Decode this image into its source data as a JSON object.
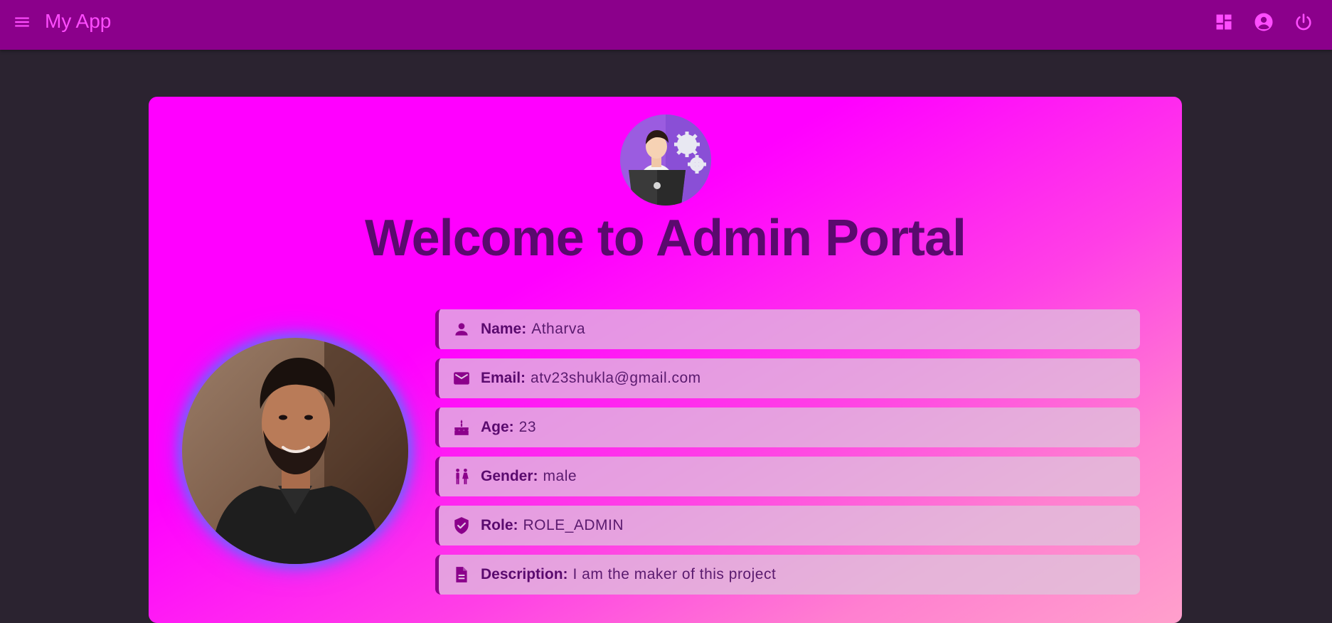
{
  "toolbar": {
    "app_title": "My App",
    "menu_icon": "menu-icon",
    "actions": [
      "dashboard-icon",
      "account-circle-icon",
      "power-icon"
    ]
  },
  "card": {
    "title": "Welcome to Admin Portal",
    "avatar": "admin-avatar-illustration",
    "profile_photo": "profile-photo"
  },
  "profile": {
    "name": {
      "label": "Name:",
      "value": "Atharva",
      "icon": "person-icon"
    },
    "email": {
      "label": "Email:",
      "value": "atv23shukla@gmail.com",
      "icon": "mail-icon"
    },
    "age": {
      "label": "Age:",
      "value": "23",
      "icon": "cake-icon"
    },
    "gender": {
      "label": "Gender:",
      "value": "male",
      "icon": "wc-icon"
    },
    "role": {
      "label": "Role:",
      "value": "ROLE_ADMIN",
      "icon": "verified-user-icon"
    },
    "description": {
      "label": "Description:",
      "value": "I am the maker of this project",
      "icon": "description-icon"
    }
  },
  "colors": {
    "toolbar_bg": "#8b008b",
    "toolbar_fg": "#ff4dff",
    "page_bg": "#2b2330",
    "card_gradient_start": "#ff00ff",
    "card_gradient_end": "#ffa0cc",
    "title_color": "#5a0a6e",
    "accent": "#8b008b"
  }
}
